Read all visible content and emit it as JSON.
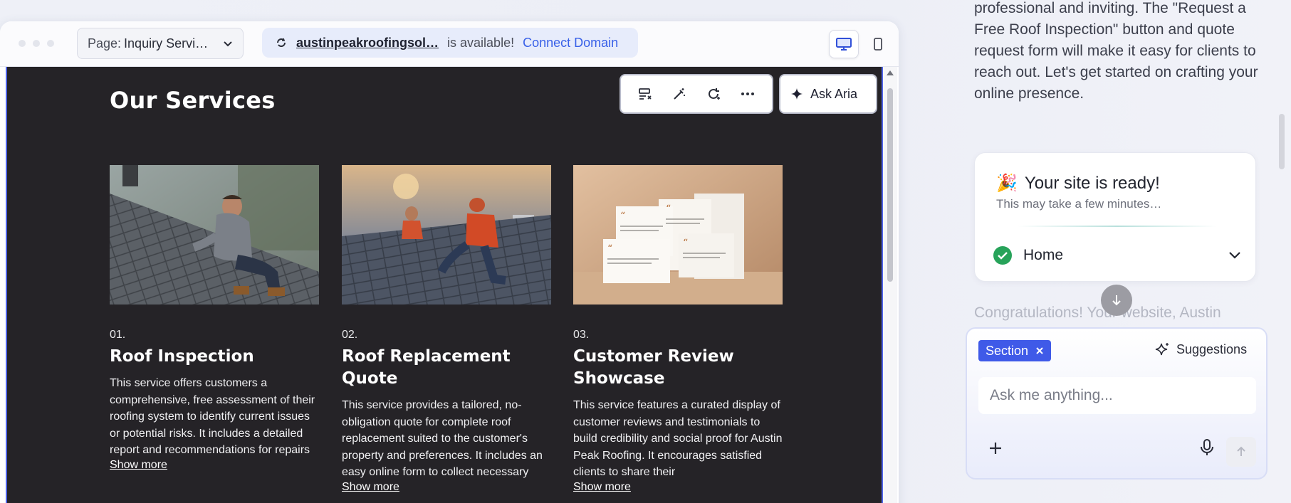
{
  "topbar": {
    "page_prefix": "Page:",
    "page_value": "Inquiry Servi…",
    "domain": "austinpeakroofingsol…",
    "available_text": "is available!",
    "connect_label": "Connect Domain"
  },
  "section": {
    "title": "Our Services",
    "ask_aria_label": "Ask Aria"
  },
  "services": [
    {
      "number": "01.",
      "title": "Roof Inspection",
      "description": "This service offers customers a comprehensive, free assessment of their roofing system to identify current issues or potential risks. It includes a detailed report and recommendations for repairs",
      "more": "Show more"
    },
    {
      "number": "02.",
      "title": "Roof Replacement Quote",
      "description": "This service provides a tailored, no-obligation quote for complete roof replacement suited to the customer's property and preferences. It includes an easy online form to collect necessary",
      "more": "Show more"
    },
    {
      "number": "03.",
      "title": "Customer Review Showcase",
      "description": "This service features a curated display of customer reviews and testimonials to build credibility and social proof for Austin Peak Roofing. It encourages satisfied clients to share their",
      "more": "Show more"
    }
  ],
  "assistant": {
    "intro_text": "professional and inviting. The \"Request a Free Roof Inspection\" button and quote request form will make it easy for clients to reach out. Let's get started on crafting your online presence.",
    "ready_title": "Your site is ready!",
    "ready_emoji": "🎉",
    "ready_sub": "This may take a few minutes…",
    "page_row": "Home",
    "faded_text": "Congratulations! Your website, Austin",
    "chip_label": "Section",
    "suggestions_label": "Suggestions",
    "input_placeholder": "Ask me anything..."
  },
  "colors": {
    "accent": "#3f5ae8",
    "canvas_bg": "#252327",
    "success": "#27a35a",
    "link": "#3860e8"
  }
}
